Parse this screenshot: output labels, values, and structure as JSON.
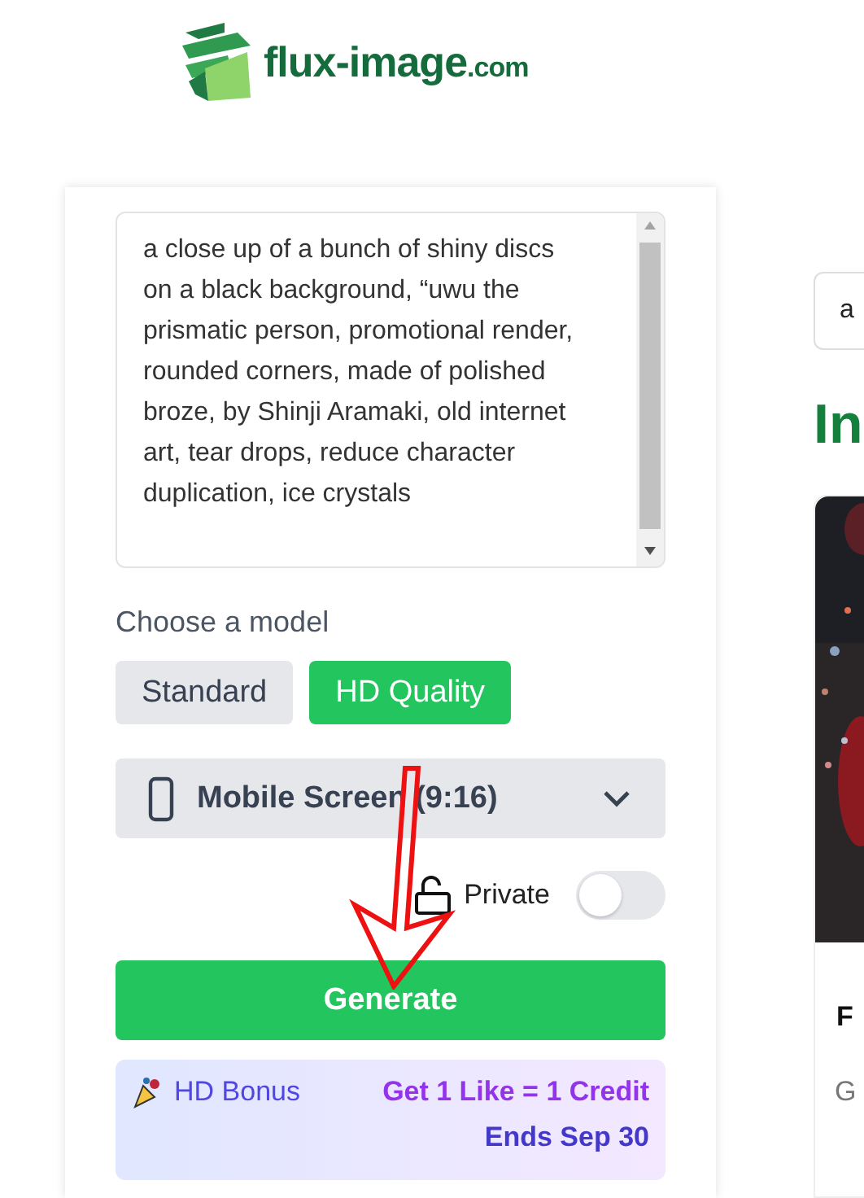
{
  "logo": {
    "name": "flux-image",
    "suffix": ".com"
  },
  "prompt": {
    "value": "a close up of a bunch of shiny discs on a black background, “uwu the prismatic person, promotional render, rounded corners, made of polished broze, by Shinji Aramaki, old internet art, tear drops, reduce character duplication, ice crystals"
  },
  "model": {
    "label": "Choose a model",
    "options": [
      {
        "label": "Standard",
        "selected": false
      },
      {
        "label": "HD Quality",
        "selected": true
      }
    ]
  },
  "aspect": {
    "value": "Mobile Screen (9:16)"
  },
  "private": {
    "label": "Private",
    "on": false
  },
  "generate": {
    "label": "Generate"
  },
  "bonus": {
    "title": "HD Bonus",
    "offer": "Get 1 Like = 1 Credit",
    "ends": "Ends Sep 30"
  },
  "right": {
    "search_value": "a",
    "heading": "In",
    "card": {
      "kind": "picture",
      "title": "F",
      "subtitle": "G"
    }
  }
}
